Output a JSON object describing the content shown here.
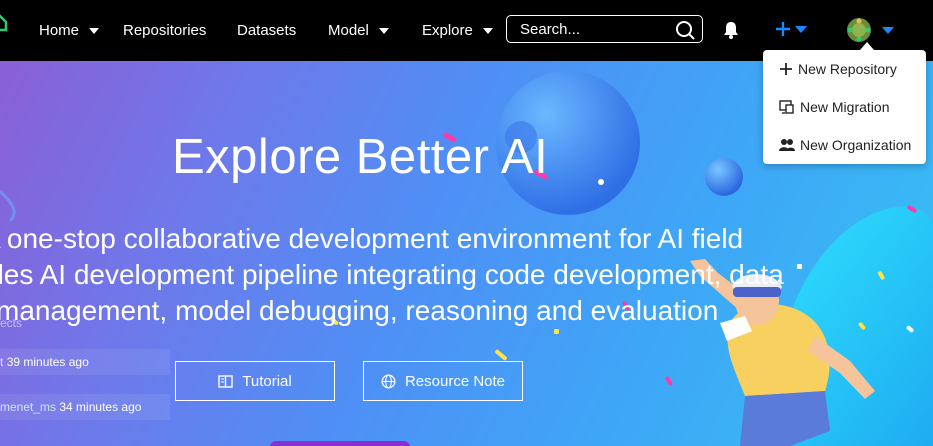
{
  "nav": {
    "home": "Home",
    "repositories": "Repositories",
    "datasets": "Datasets",
    "model": "Model",
    "explore": "Explore",
    "search_placeholder": "Search..."
  },
  "create_menu": {
    "items": [
      {
        "label": "New Repository",
        "icon": "plus-icon"
      },
      {
        "label": "New Migration",
        "icon": "migration-icon"
      },
      {
        "label": "New Organization",
        "icon": "organization-icon"
      }
    ]
  },
  "hero": {
    "title": "Explore Better AI",
    "lines": [
      "A one-stop collaborative development environment for AI field",
      "ides AI development pipeline integrating code development, data",
      "management, model debugging, reasoning and evaluation"
    ],
    "buttons": {
      "tutorial": "Tutorial",
      "resource_note": "Resource Note"
    }
  },
  "activity": [
    {
      "user": "t",
      "time": "39 minutes ago"
    },
    {
      "user": "menet_ms",
      "time": "34 minutes ago"
    }
  ],
  "activity_header": "ects",
  "colors": {
    "nav_bg": "#000000",
    "accent": "#1e88ff",
    "hero_start": "#8a5fd6",
    "hero_end": "#37c1f3"
  }
}
